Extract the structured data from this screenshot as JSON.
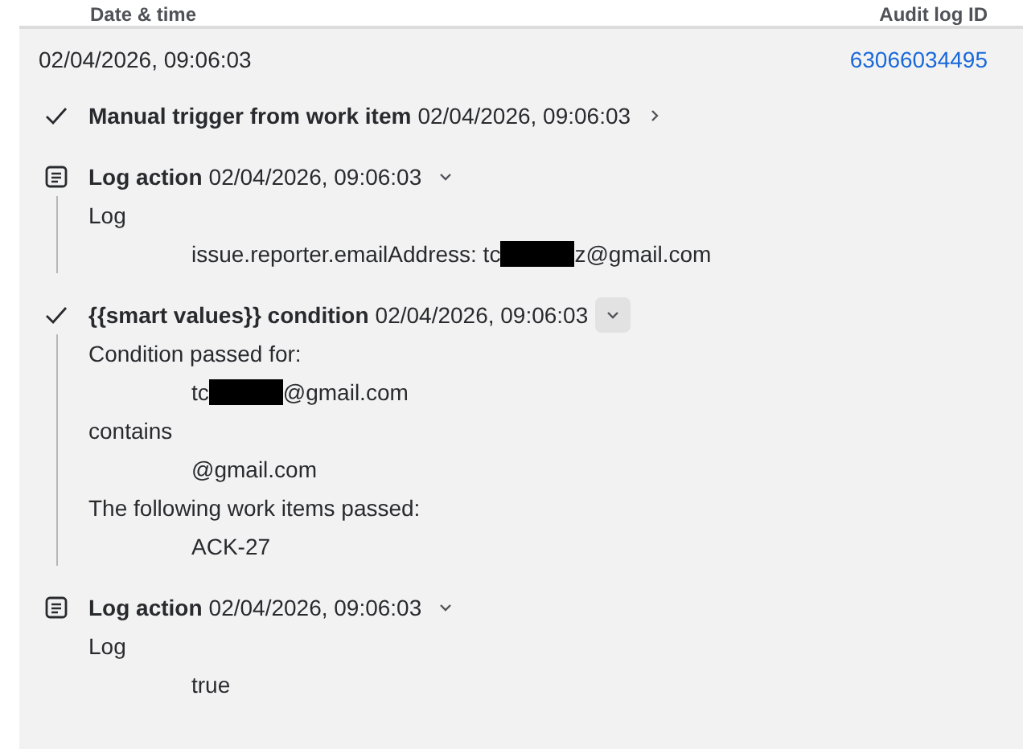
{
  "table": {
    "columns": [
      "Date & time",
      "Audit log ID"
    ],
    "row": {
      "date_time": "02/04/2026, 09:06:03",
      "audit_log_id": "63066034495"
    }
  },
  "steps": [
    {
      "kind": "check",
      "title": "Manual trigger from work item",
      "time": "02/04/2026, 09:06:03",
      "expanded": false,
      "highlighted": false
    },
    {
      "kind": "log",
      "title": "Log action",
      "time": "02/04/2026, 09:06:03",
      "expanded": true,
      "highlighted": false,
      "details": [
        {
          "indent": false,
          "parts": [
            {
              "text": "Log"
            }
          ]
        },
        {
          "indent": true,
          "parts": [
            {
              "text": "issue.reporter.emailAddress: tc"
            },
            {
              "kind": "redaction"
            },
            {
              "text": "z@gmail.com"
            }
          ]
        }
      ]
    },
    {
      "kind": "check",
      "title": "{{smart values}} condition",
      "time": "02/04/2026, 09:06:03",
      "expanded": true,
      "highlighted": true,
      "details": [
        {
          "indent": false,
          "parts": [
            {
              "text": "Condition passed for:"
            }
          ]
        },
        {
          "indent": true,
          "parts": [
            {
              "text": "tc"
            },
            {
              "kind": "redaction"
            },
            {
              "text": "@gmail.com"
            }
          ]
        },
        {
          "indent": false,
          "parts": [
            {
              "text": "contains"
            }
          ]
        },
        {
          "indent": true,
          "parts": [
            {
              "text": "@gmail.com"
            }
          ]
        },
        {
          "indent": false,
          "parts": [
            {
              "text": "The following work items passed:"
            }
          ]
        },
        {
          "indent": true,
          "parts": [
            {
              "text": "ACK-27"
            }
          ]
        }
      ]
    },
    {
      "kind": "log",
      "title": "Log action",
      "time": "02/04/2026, 09:06:03",
      "expanded": true,
      "highlighted": false,
      "details": [
        {
          "indent": false,
          "parts": [
            {
              "text": "Log"
            }
          ]
        },
        {
          "indent": true,
          "parts": [
            {
              "text": "true"
            }
          ]
        }
      ]
    }
  ]
}
